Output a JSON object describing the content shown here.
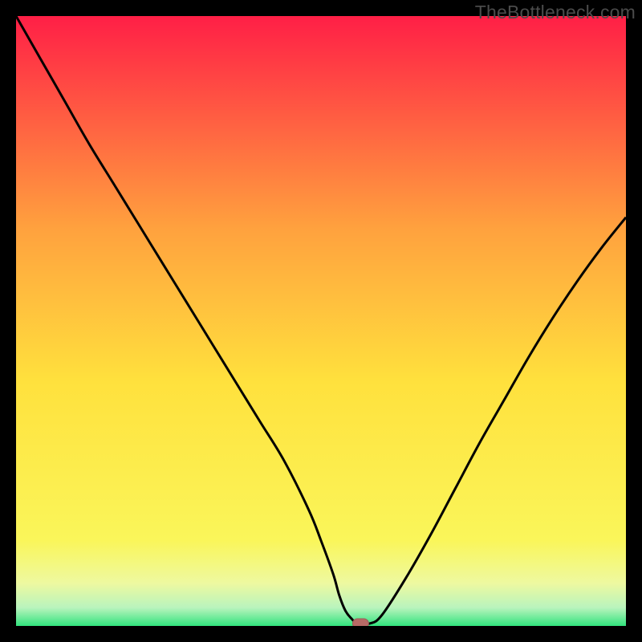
{
  "watermark": "TheBottleneck.com",
  "colors": {
    "frame": "#000000",
    "curve_stroke": "#000000",
    "marker_fill": "#b86a66",
    "marker_stroke": "#9b5a58",
    "gradient_top": "#ff1f46",
    "gradient_mid_upper": "#ffa23e",
    "gradient_mid": "#ffe13d",
    "gradient_mid_lower": "#faf65a",
    "gradient_low1": "#eef9a0",
    "gradient_low2": "#b9f4bd",
    "gradient_bottom": "#32e37d"
  },
  "chart_data": {
    "type": "line",
    "title": "",
    "xlabel": "",
    "ylabel": "",
    "xlim": [
      0,
      100
    ],
    "ylim": [
      0,
      100
    ],
    "grid": false,
    "legend": false,
    "series": [
      {
        "name": "bottleneck-curve",
        "x": [
          0,
          4,
          8,
          12,
          16,
          20,
          24,
          28,
          32,
          36,
          40,
          44,
          48,
          50,
          52,
          53,
          54,
          55,
          56,
          58,
          60,
          64,
          68,
          72,
          76,
          80,
          84,
          88,
          92,
          96,
          100
        ],
        "y": [
          100,
          93,
          86,
          79,
          72.5,
          66,
          59.5,
          53,
          46.5,
          40,
          33.5,
          27,
          19,
          14,
          8.5,
          5,
          2.5,
          1.2,
          0.4,
          0.4,
          1.8,
          8,
          15,
          22.5,
          30,
          37,
          44,
          50.5,
          56.5,
          62,
          67
        ]
      }
    ],
    "marker": {
      "name": "minimum-marker",
      "x": 56.5,
      "y": 0.4
    }
  }
}
